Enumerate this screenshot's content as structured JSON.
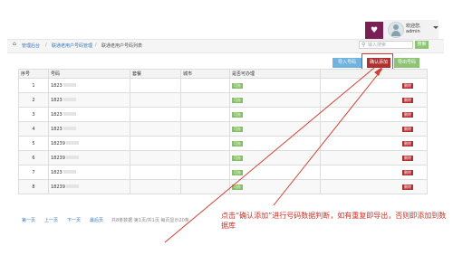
{
  "header": {
    "bell_icon": "bell-icon",
    "greeting": "欢迎您,",
    "username": "admin"
  },
  "breadcrumb": {
    "items": [
      "管理后台",
      "联通老用户号码管理",
      "联通老用户号码列表"
    ],
    "separator": "/"
  },
  "search": {
    "placeholder": "输入搜索",
    "button": "搜索"
  },
  "toolbar": {
    "import": "导入号码",
    "confirm": "确认添加",
    "export": "导出号码"
  },
  "table": {
    "columns": [
      "序号",
      "号码",
      "套餐",
      "城市",
      "是否可办理",
      ""
    ],
    "rows": [
      {
        "no": "1",
        "number": "1823",
        "status": "可办",
        "action": "删除"
      },
      {
        "no": "2",
        "number": "1823",
        "status": "可办",
        "action": "删除"
      },
      {
        "no": "3",
        "number": "1823",
        "status": "可办",
        "action": "删除"
      },
      {
        "no": "4",
        "number": "1823",
        "status": "可办",
        "action": "删除"
      },
      {
        "no": "5",
        "number": "18239",
        "status": "可办",
        "action": "删除"
      },
      {
        "no": "6",
        "number": "18239",
        "status": "可办",
        "action": "删除"
      },
      {
        "no": "7",
        "number": "1823",
        "status": "可办",
        "action": "删除"
      },
      {
        "no": "8",
        "number": "18239",
        "status": "可办",
        "action": "删除"
      }
    ]
  },
  "pagination": {
    "first": "第一页",
    "prev": "上一页",
    "next": "下一页",
    "last": "最后页",
    "info": "共8条数据 第1页/共1页 每页显示20条"
  },
  "annotation": {
    "text": "点击“确认添加”进行号码数据判断，如有重复即导出，否则即添加到数据库",
    "color": "#d03020"
  }
}
